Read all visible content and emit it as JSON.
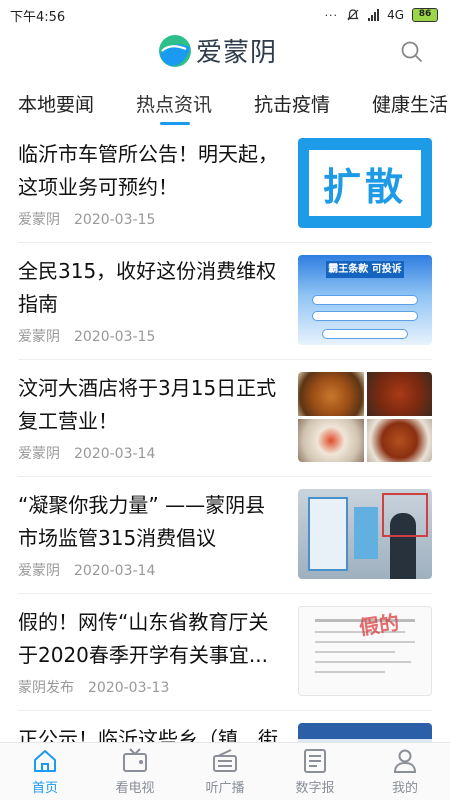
{
  "status_bar": {
    "time": "下午4:56",
    "network": "4G",
    "battery": "86"
  },
  "header": {
    "app_name": "爱蒙阴",
    "brand_color": "#1a9af0"
  },
  "tabs": [
    {
      "label": "本地要闻",
      "active": false
    },
    {
      "label": "热点资讯",
      "active": true
    },
    {
      "label": "抗击疫情",
      "active": false
    },
    {
      "label": "健康生活",
      "active": false
    }
  ],
  "news": [
    {
      "title": "临沂市车管所公告！明天起，这项业务可预约！",
      "source": "爱蒙阴",
      "date": "2020-03-15",
      "thumb_text": "扩散"
    },
    {
      "title": "全民315，收好这份消费维权指南",
      "source": "爱蒙阴",
      "date": "2020-03-15",
      "thumb_text": "霸王条款 可投诉"
    },
    {
      "title": "汶河大酒店将于3月15日正式复工营业！",
      "source": "爱蒙阴",
      "date": "2020-03-14"
    },
    {
      "title": "“凝聚你我力量” ——蒙阴县市场监管315消费倡议",
      "source": "爱蒙阴",
      "date": "2020-03-14"
    },
    {
      "title": "假的！网传“山东省教育厅关于2020春季开学有关事宜...",
      "source": "蒙阴发布",
      "date": "2020-03-13",
      "thumb_text": "假的"
    },
    {
      "title": "正公示！临沂这些乡（镇、街",
      "source": "",
      "date": ""
    }
  ],
  "bottom_nav": [
    {
      "label": "首页",
      "icon": "home-icon",
      "active": true
    },
    {
      "label": "看电视",
      "icon": "tv-icon",
      "active": false
    },
    {
      "label": "听广播",
      "icon": "radio-icon",
      "active": false
    },
    {
      "label": "数字报",
      "icon": "newspaper-icon",
      "active": false
    },
    {
      "label": "我的",
      "icon": "user-icon",
      "active": false
    }
  ]
}
